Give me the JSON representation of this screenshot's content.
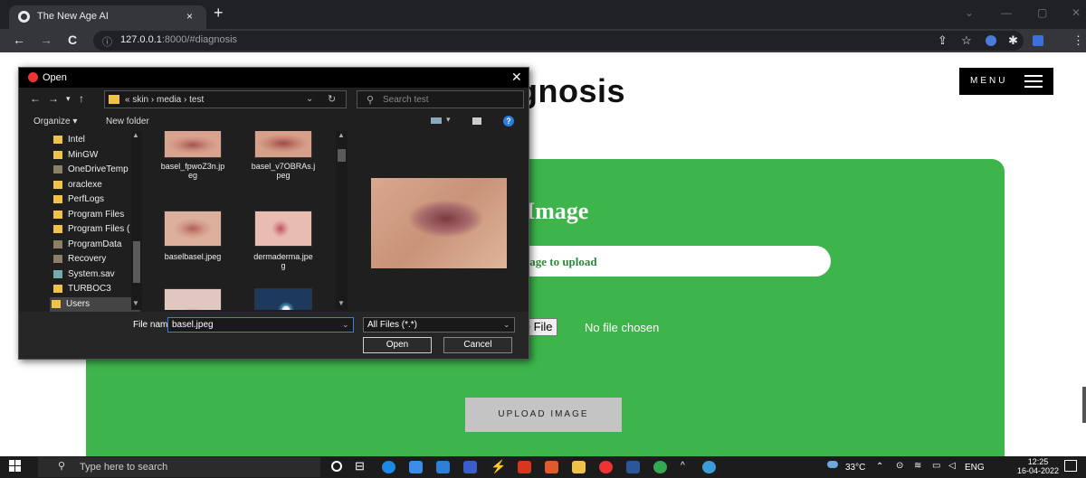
{
  "browser": {
    "tab_title": "The New Age AI",
    "tab_close": "×",
    "new_tab": "+",
    "url_host": "127.0.0.1",
    "url_rest": ":8000/#diagnosis",
    "url_info": "ⓘ",
    "back": "←",
    "forward": "→",
    "reload": "C",
    "window_min": "—",
    "window_restore": "▢",
    "window_close": "✕",
    "window_chevron": "⌄"
  },
  "page": {
    "title_fragment": "gnosis",
    "menu_label": "MENU",
    "upload_heading_fragment": "d Image",
    "input_text_fragment": "nage to upload",
    "choose_file_fragment": "ose File",
    "no_file": "No file chosen",
    "upload_button": "UPLOAD IMAGE",
    "colors": {
      "panel": "#3db54a",
      "menu_bg": "#000000"
    }
  },
  "dialog": {
    "title": "Open",
    "close": "✕",
    "path": "« skin › media › test",
    "search_placeholder": "Search test",
    "organize": "Organize ▾",
    "new_folder": "New folder",
    "tree": [
      {
        "label": "Intel",
        "icon": "folder"
      },
      {
        "label": "MinGW",
        "icon": "folder"
      },
      {
        "label": "OneDriveTemp",
        "icon": "folder-gray"
      },
      {
        "label": "oraclexe",
        "icon": "folder"
      },
      {
        "label": "PerfLogs",
        "icon": "folder"
      },
      {
        "label": "Program Files",
        "icon": "folder"
      },
      {
        "label": "Program Files (",
        "icon": "folder"
      },
      {
        "label": "ProgramData",
        "icon": "folder-gray"
      },
      {
        "label": "Recovery",
        "icon": "folder-gray"
      },
      {
        "label": "System.sav",
        "icon": "system"
      },
      {
        "label": "TURBOC3",
        "icon": "folder"
      },
      {
        "label": "Users",
        "icon": "folder"
      }
    ],
    "files": [
      {
        "name": "basel_fpwoZ3n.jpeg",
        "line1": "basel_fpwoZ3n.jp",
        "line2": "eg"
      },
      {
        "name": "basel_v7OBRAs.jpeg",
        "line1": "basel_v7OBRAs.j",
        "line2": "peg"
      },
      {
        "name": "baselbasel.jpeg",
        "line1": "baselbasel.jpeg",
        "line2": ""
      },
      {
        "name": "dermaderma.jpeg",
        "line1": "dermaderma.jpe",
        "line2": "g"
      },
      {
        "name": "",
        "line1": "",
        "line2": ""
      },
      {
        "name": "",
        "line1": "",
        "line2": ""
      }
    ],
    "file_name_label": "File name:",
    "file_name_value": "basel.jpeg",
    "file_type": "All Files (*.*)",
    "open": "Open",
    "cancel": "Cancel"
  },
  "taskbar": {
    "search_placeholder": "Type here to search",
    "weather": "33°C",
    "language": "ENG",
    "time": "12:25",
    "date": "16-04-2022"
  }
}
